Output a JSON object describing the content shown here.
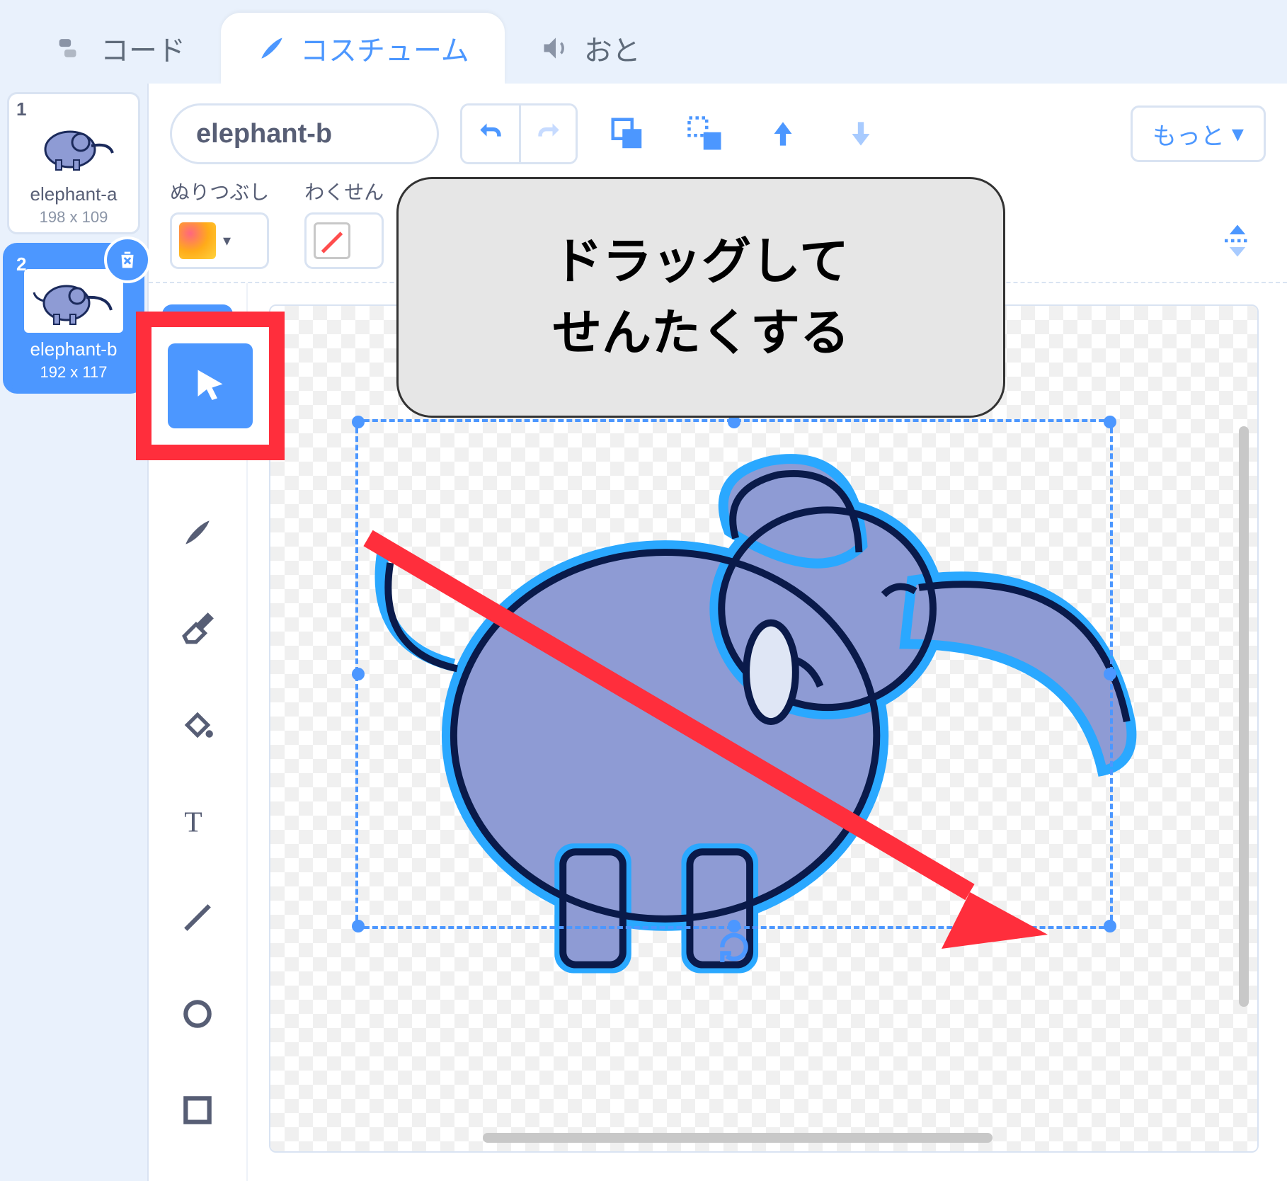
{
  "tabs": {
    "code": "コード",
    "costumes": "コスチューム",
    "sounds": "おと"
  },
  "costumes_list": [
    {
      "num": "1",
      "name": "elephant-a",
      "size": "198 x 109"
    },
    {
      "num": "2",
      "name": "elephant-b",
      "size": "192 x 117"
    }
  ],
  "editor": {
    "costume_name": "elephant-b",
    "more_label": "もっと",
    "fill_label": "ぬりつぶし",
    "outline_label": "わくせん"
  },
  "tools": {
    "select": "select-tool",
    "reshape": "reshape-tool",
    "brush": "brush-tool",
    "eraser": "eraser-tool",
    "fill": "fill-tool",
    "text": "text-tool",
    "line": "line-tool",
    "circle": "circle-tool",
    "rect": "rect-tool"
  },
  "annotation": {
    "callout_line1": "ドラッグして",
    "callout_line2": "せんたくする"
  },
  "colors": {
    "accent": "#4c97ff",
    "highlight": "#ff2e3c"
  }
}
